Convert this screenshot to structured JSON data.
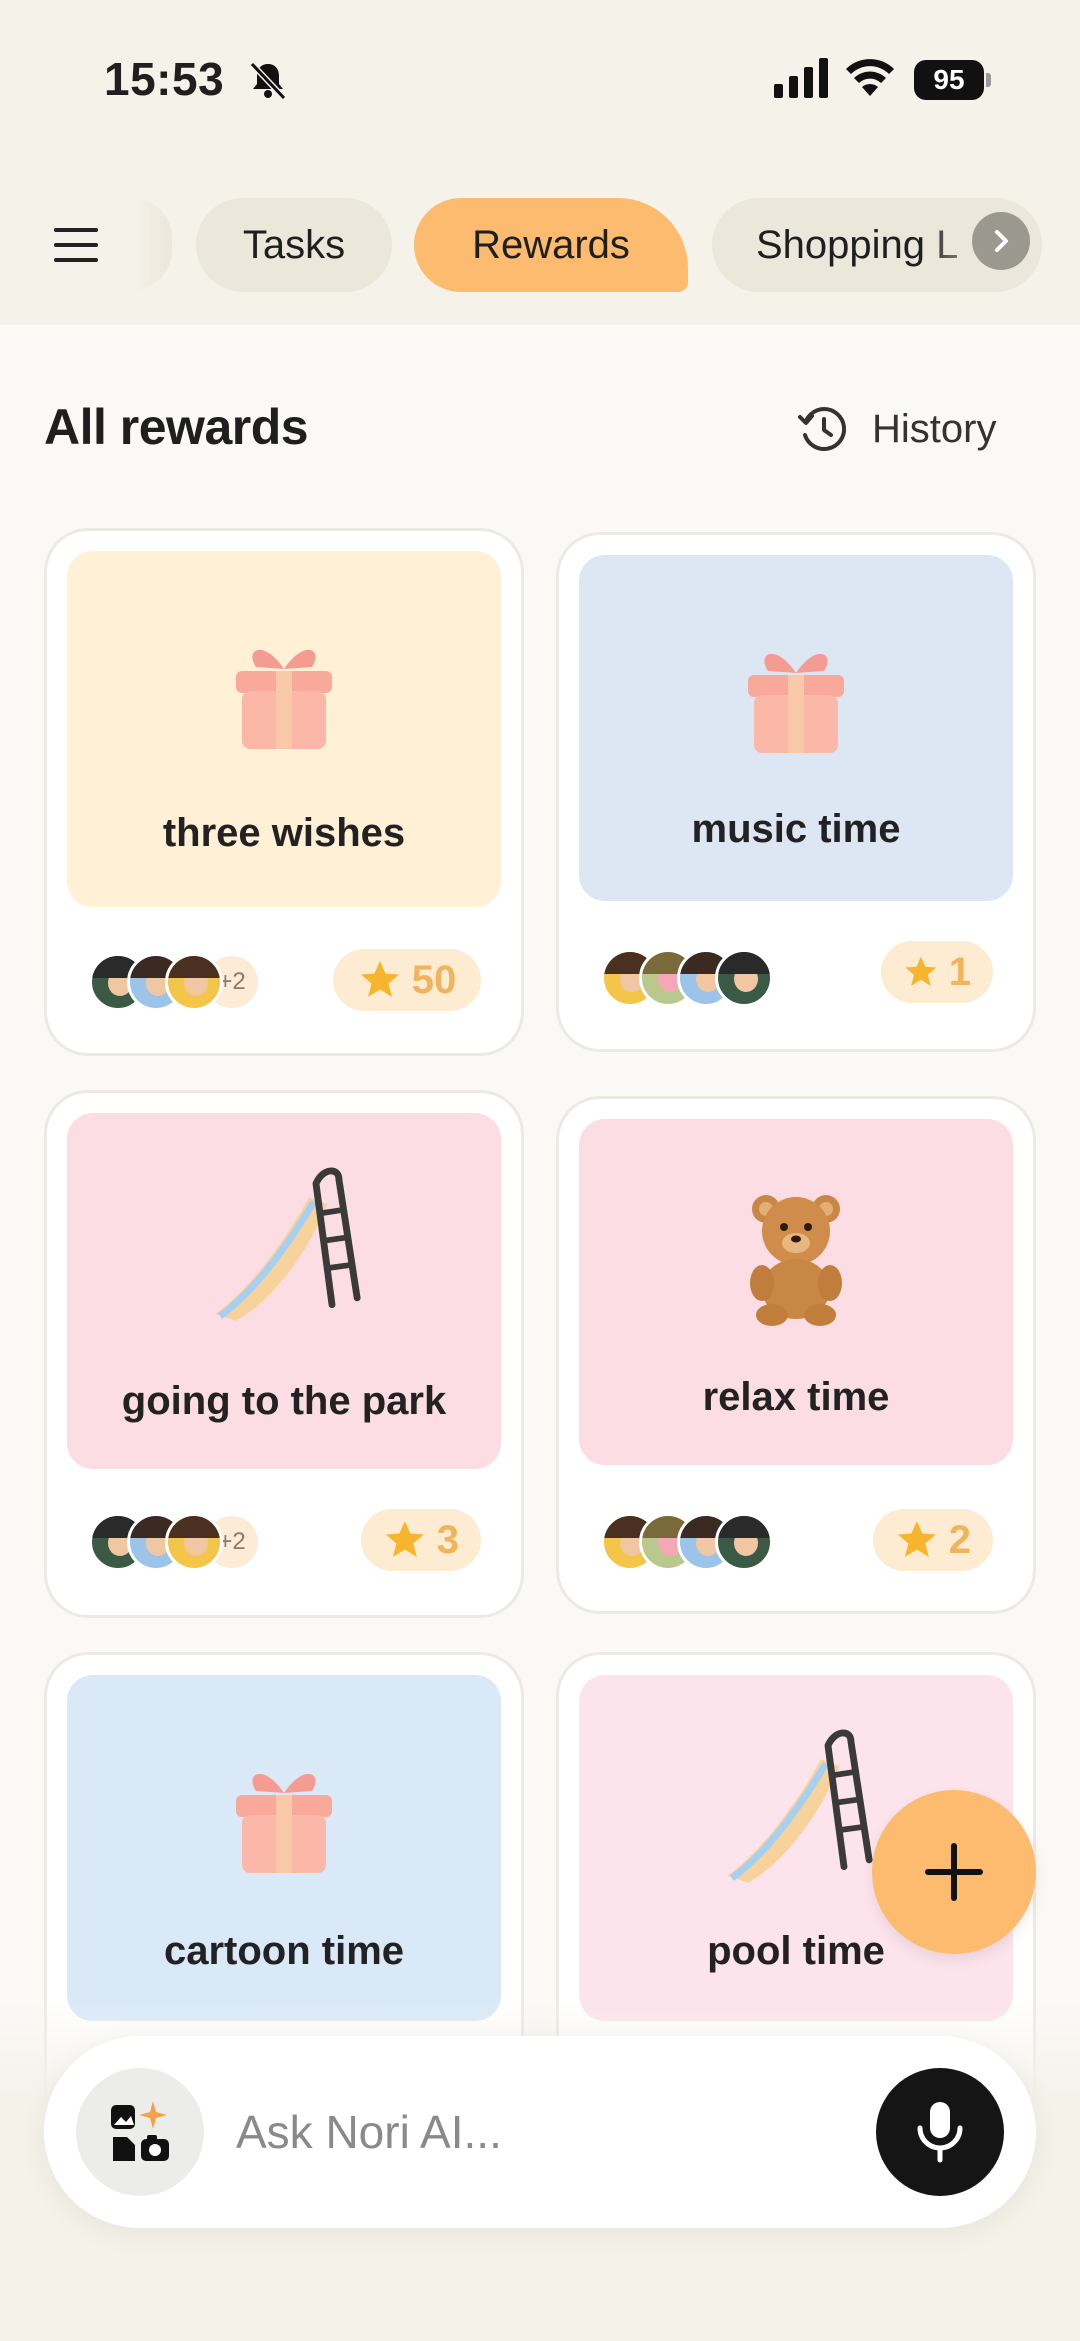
{
  "status_bar": {
    "time": "15:53",
    "battery": "95"
  },
  "tabs": [
    {
      "label": "Tasks"
    },
    {
      "label": "Rewards"
    },
    {
      "label": "Shopping L"
    }
  ],
  "header": {
    "title": "All rewards",
    "history_label": "History"
  },
  "rewards": [
    {
      "title": "three wishes",
      "points": "50",
      "extra_avatars": "+2",
      "icon": "gift-icon",
      "bg": "#FFF0D6"
    },
    {
      "title": "music time",
      "points": "1",
      "icon": "gift-icon",
      "bg": "#DCE7F3"
    },
    {
      "title": "going to the park",
      "points": "3",
      "extra_avatars": "+2",
      "icon": "slide-icon",
      "bg": "#FCDDE4"
    },
    {
      "title": "relax time",
      "points": "2",
      "icon": "teddy-bear-icon",
      "bg": "#FCDDE4"
    },
    {
      "title": "cartoon time",
      "icon": "gift-icon",
      "bg": "#D9E9F8"
    },
    {
      "title": "pool time",
      "icon": "slide-icon",
      "bg": "#FDE3EC"
    }
  ],
  "colors": {
    "accent": "#FCBB6E",
    "tab_bg": "#ECE7DB",
    "star": "#F7B52E"
  },
  "ask_bar": {
    "placeholder": "Ask Nori AI..."
  }
}
